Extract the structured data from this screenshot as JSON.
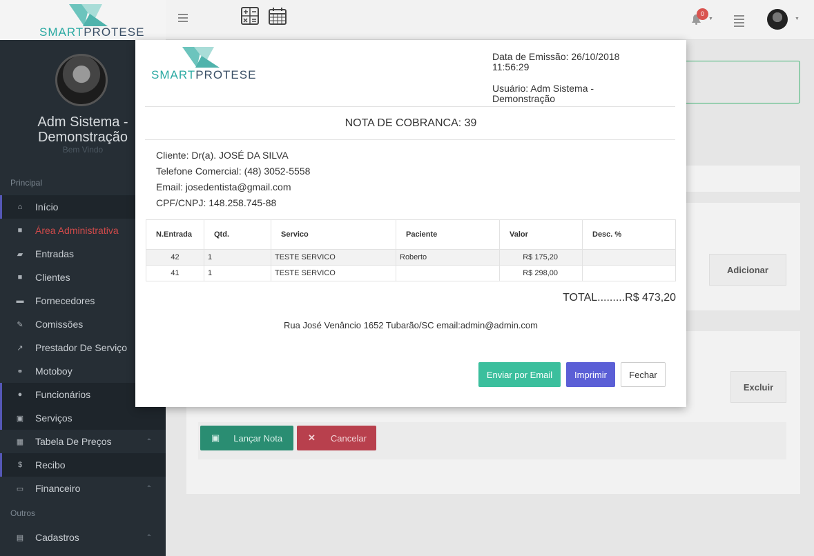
{
  "header": {
    "brand_bold": "SMART",
    "brand_light": "PROTESE",
    "notification_count": "0"
  },
  "sidebar": {
    "profile_name": "Adm Sistema - Demonstração",
    "welcome": "Bem Vindo",
    "section_principal": "Principal",
    "section_outros": "Outros",
    "items": [
      {
        "label": "Início",
        "icon": "home-icon"
      },
      {
        "label": "Área Administrativa",
        "icon": "lock-icon"
      },
      {
        "label": "Entradas",
        "icon": "book-icon"
      },
      {
        "label": "Clientes",
        "icon": "lock-icon"
      },
      {
        "label": "Fornecedores",
        "icon": "briefcase-icon"
      },
      {
        "label": "Comissões",
        "icon": "pen-icon"
      },
      {
        "label": "Prestador De Serviço",
        "icon": "share-icon"
      },
      {
        "label": "Motoboy",
        "icon": "motorcycle-icon"
      },
      {
        "label": "Funcionários",
        "icon": "user-icon"
      },
      {
        "label": "Serviços",
        "icon": "edit-icon"
      },
      {
        "label": "Tabela De Preços",
        "icon": "table-icon"
      },
      {
        "label": "Recibo",
        "icon": "dollar-icon"
      },
      {
        "label": "Financeiro",
        "icon": "money-icon"
      },
      {
        "label": "Cadastros",
        "icon": "save-icon"
      }
    ]
  },
  "background": {
    "adicionar": "Adicionar",
    "excluir": "Excluir",
    "lancar_nota": "Lançar Nota",
    "cancelar": "Cancelar"
  },
  "modal": {
    "logo_a": "SMART",
    "logo_b": "PROTESE",
    "emission": "Data de Emissão: 26/10/2018 11:56:29",
    "user": "Usuário: Adm Sistema - Demonstração",
    "title": "NOTA DE COBRANCA: 39",
    "cliente": "Cliente:   Dr(a). JOSÉ DA SILVA",
    "telefone": "Telefone Comercial:   (48) 3052-5558",
    "email": "Email: josedentista@gmail.com",
    "cpf": "CPF/CNPJ: 148.258.745-88",
    "columns": [
      "N.Entrada",
      "Qtd.",
      "Servico",
      "Paciente",
      "Valor",
      "Desc. %"
    ],
    "rows": [
      {
        "entrada": "42",
        "qtd": "1",
        "servico": "TESTE SERVICO",
        "paciente": "Roberto",
        "valor": "R$ 175,20",
        "desc": ""
      },
      {
        "entrada": "41",
        "qtd": "1",
        "servico": "TESTE SERVICO",
        "paciente": "",
        "valor": "R$ 298,00",
        "desc": ""
      }
    ],
    "total": "TOTAL.........R$ 473,20",
    "footer": "Rua José Venâncio 1652 Tubarão/SC email:admin@admin.com",
    "btn_email": "Enviar por Email",
    "btn_print": "Imprimir",
    "btn_close": "Fechar"
  }
}
